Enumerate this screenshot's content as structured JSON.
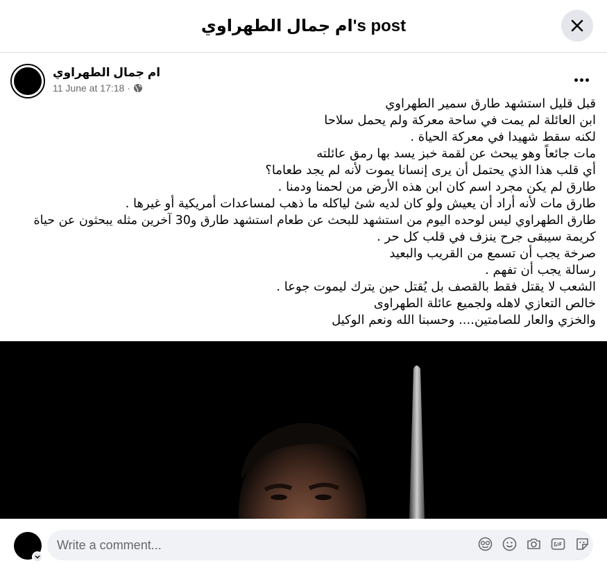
{
  "dialog": {
    "title": "ام جمال الطهراوي's post"
  },
  "post": {
    "author": "ام جمال الطهراوي",
    "timestamp": "11 June at 17:18",
    "separator": "·",
    "audience_icon": "globe-icon",
    "text_lines": [
      "قبل قليل استشهد طارق سمير الطهراوي",
      "ابن العائلة لم يمت في ساحة معركة ولم يحمل سلاحا",
      "لكنه سقط شهيدا في معركة الحياة .",
      "مات جائعاً وهو يبحث عن لقمة خبز يسد بها رمق عائلته",
      "أي قلب هذا الذي يحتمل أن يرى إنسانا يموت لأنه لم يجد طعاما؟",
      "طارق لم يكن مجرد اسم كان ابن هذه الأرض من لحمنا ودمنا .",
      "طارق مات لأنه أراد أن يعيش ولو كان لديه شئ لياكله ما ذهب لمساعدات أمريكية أو غيرها .",
      "طارق الطهراوي ليس لوحده اليوم من استشهد للبحث عن طعام استشهد طارق و30 آخرين مثله يبحثون عن حياة",
      "كريمة سيبقى جرح ينزف في قلب كل حر .",
      "صرخة يجب أن تسمع من القريب والبعيد",
      "رسالة يجب أن تفهم .",
      "الشعب لا يقتل فقط بالقصف بل يُقتل حين يترك ليموت جوعا .",
      "خالص التعازي لاهله ولجميع عائلة الطهراوى",
      "والخزي والعار للصامتين.... وحسبنا الله ونعم الوكيل"
    ]
  },
  "comment": {
    "placeholder": "Write a comment...",
    "icons": [
      "avatar-sticker-icon",
      "emoji-icon",
      "camera-icon",
      "gif-icon",
      "sticker-icon"
    ]
  },
  "colors": {
    "primary_text": "#050505",
    "secondary_text": "#65676b",
    "button_bg": "#e4e6eb",
    "input_bg": "#f0f2f5"
  }
}
